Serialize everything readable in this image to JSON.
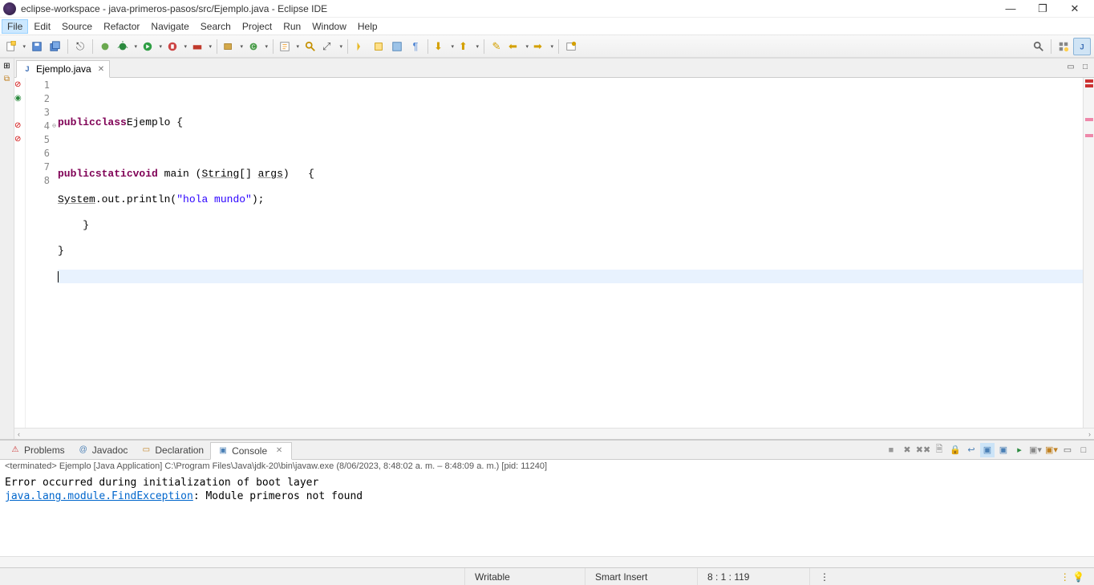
{
  "window": {
    "title": "eclipse-workspace - java-primeros-pasos/src/Ejemplo.java - Eclipse IDE"
  },
  "menu": {
    "items": [
      "File",
      "Edit",
      "Source",
      "Refactor",
      "Navigate",
      "Search",
      "Project",
      "Run",
      "Window",
      "Help"
    ],
    "active": "File"
  },
  "editor": {
    "tab_label": "Ejemplo.java",
    "kw_public": "public",
    "kw_class": "class",
    "cls_name": "Ejemplo",
    "brace_open": " {",
    "kw_static": "static",
    "kw_void": "void",
    "m_main": " main (",
    "t_string": "String",
    "m_main2": "[] ",
    "p_args": "args",
    "m_main3": ")   {",
    "sys": "System",
    "sys2": ".out.println(",
    "str": "\"hola mundo\"",
    "sys3": ");",
    "brace_close1": "    }",
    "brace_close2": "}",
    "lines": [
      "1",
      "2",
      "3",
      "4",
      "5",
      "6",
      "7",
      "8"
    ]
  },
  "bottom": {
    "tabs": {
      "problems": "Problems",
      "javadoc": "Javadoc",
      "declaration": "Declaration",
      "console": "Console"
    },
    "console_header": "<terminated> Ejemplo [Java Application] C:\\Program Files\\Java\\jdk-20\\bin\\javaw.exe  (8/06/2023, 8:48:02 a. m. – 8:48:09 a. m.) [pid: 11240]",
    "console_line1": "Error occurred during initialization of boot layer",
    "console_link": "java.lang.module.FindException",
    "console_line2_rest": ": Module primeros not found"
  },
  "status": {
    "writable": "Writable",
    "insert": "Smart Insert",
    "pos": "8 : 1 : 119"
  }
}
